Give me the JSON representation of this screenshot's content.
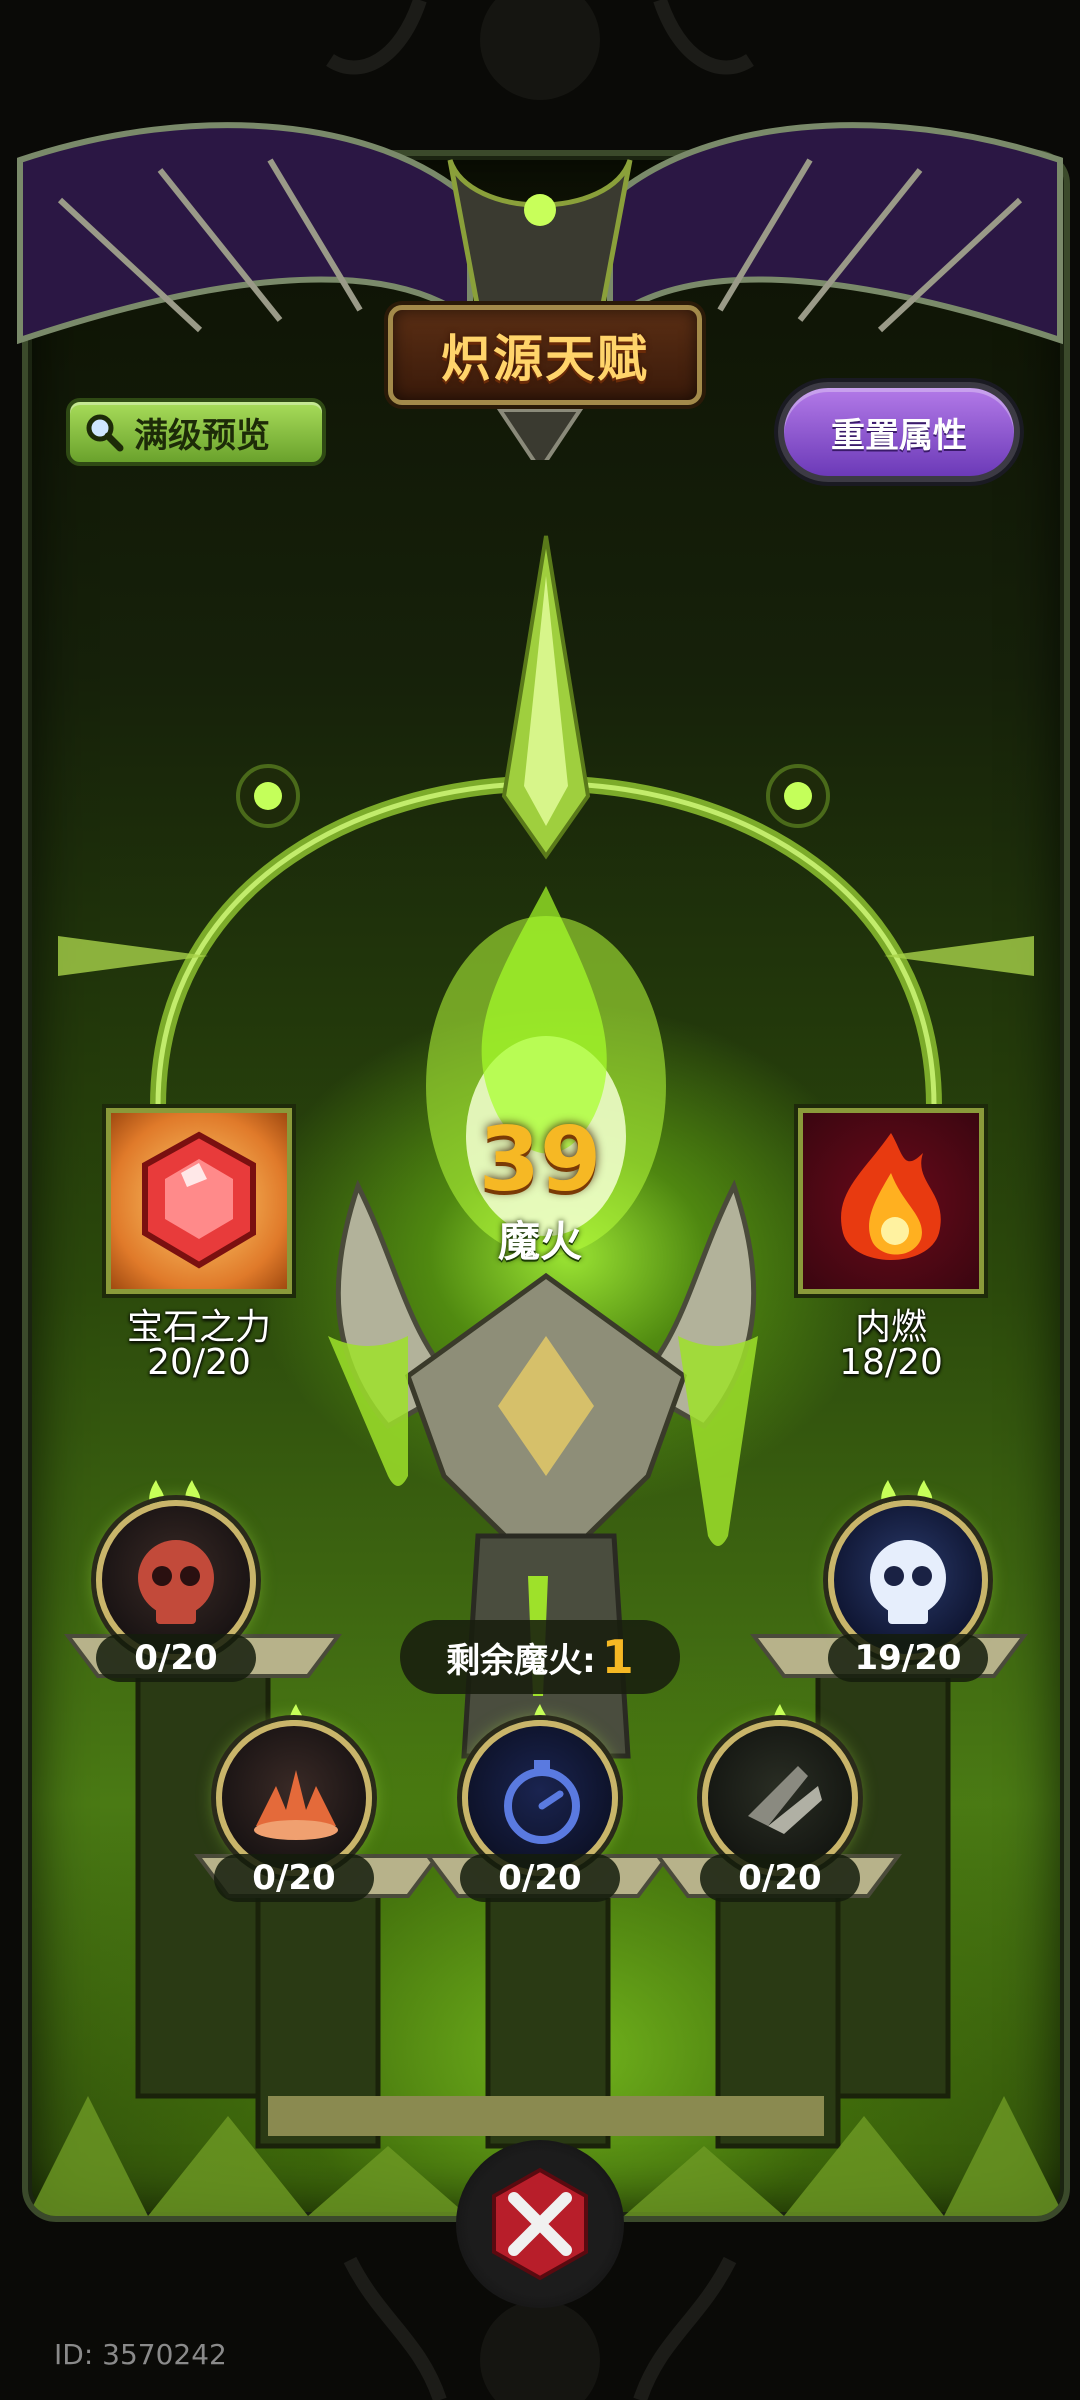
{
  "header": {
    "title": "炽源天赋"
  },
  "toolbar": {
    "preview_label": "满级预览",
    "reset_label": "重置属性"
  },
  "center": {
    "fire_count": "39",
    "fire_label": "魔火"
  },
  "square_skills": [
    {
      "name": "宝石之力",
      "level": "20/20",
      "icon": "red-gem-icon"
    },
    {
      "name": "内燃",
      "level": "18/20",
      "icon": "fireball-icon"
    }
  ],
  "nodes": [
    {
      "count": "0/20",
      "icon": "red-skull-icon",
      "flames": 2
    },
    {
      "count": "19/20",
      "icon": "blue-skull-icon",
      "flames": 2
    },
    {
      "count": "0/20",
      "icon": "spike-burst-icon",
      "flames": 1
    },
    {
      "count": "0/20",
      "icon": "stopwatch-icon",
      "flames": 1
    },
    {
      "count": "0/20",
      "icon": "wind-slash-icon",
      "flames": 1
    }
  ],
  "remaining": {
    "label": "剩余魔火:",
    "value": "1"
  },
  "footer": {
    "player_id": "ID: 3570242"
  },
  "colors": {
    "accent_green": "#9fd93a",
    "gold": "#f6b824",
    "purple": "#8a4ad0"
  }
}
